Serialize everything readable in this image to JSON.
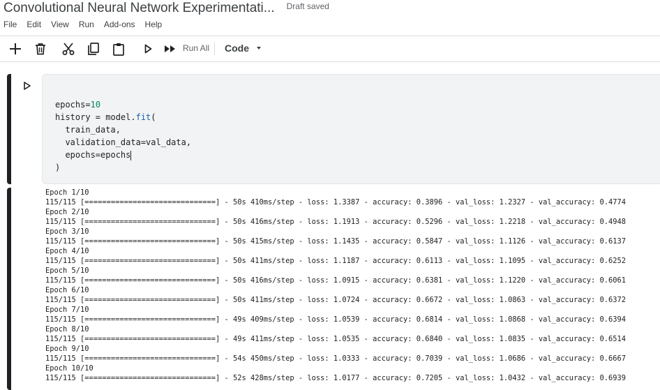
{
  "notebook": {
    "title": "Convolutional Neural Network Experimentati...",
    "save_status": "Draft saved"
  },
  "menu": [
    "File",
    "Edit",
    "View",
    "Run",
    "Add-ons",
    "Help"
  ],
  "toolbar": {
    "icons": [
      "plus-icon",
      "trash-icon",
      "scissors-icon",
      "copy-icon",
      "clipboard-icon",
      "play-icon",
      "fast-forward-icon"
    ],
    "run_all_label": "Run All",
    "cell_type": "Code"
  },
  "code_cell": {
    "line1": {
      "var": "epochs",
      "eq": "=",
      "num": "10"
    },
    "line2": {
      "pre": "history = model.",
      "fn": "fit",
      "post": "("
    },
    "line3": "  train_data,",
    "line4": "  validation_data=val_data,",
    "line5": "  epochs=epochs",
    "line6": ")"
  },
  "output": {
    "epochs": [
      {
        "header": "Epoch 1/10",
        "progress": "115/115 [==============================] - 50s 410ms/step - loss: 1.3387 - accuracy: 0.3896 - val_loss: 1.2327 - val_accuracy: 0.4774"
      },
      {
        "header": "Epoch 2/10",
        "progress": "115/115 [==============================] - 50s 416ms/step - loss: 1.1913 - accuracy: 0.5296 - val_loss: 1.2218 - val_accuracy: 0.4948"
      },
      {
        "header": "Epoch 3/10",
        "progress": "115/115 [==============================] - 50s 415ms/step - loss: 1.1435 - accuracy: 0.5847 - val_loss: 1.1126 - val_accuracy: 0.6137"
      },
      {
        "header": "Epoch 4/10",
        "progress": "115/115 [==============================] - 50s 411ms/step - loss: 1.1187 - accuracy: 0.6113 - val_loss: 1.1095 - val_accuracy: 0.6252"
      },
      {
        "header": "Epoch 5/10",
        "progress": "115/115 [==============================] - 50s 416ms/step - loss: 1.0915 - accuracy: 0.6381 - val_loss: 1.1220 - val_accuracy: 0.6061"
      },
      {
        "header": "Epoch 6/10",
        "progress": "115/115 [==============================] - 50s 411ms/step - loss: 1.0724 - accuracy: 0.6672 - val_loss: 1.0863 - val_accuracy: 0.6372"
      },
      {
        "header": "Epoch 7/10",
        "progress": "115/115 [==============================] - 49s 409ms/step - loss: 1.0539 - accuracy: 0.6814 - val_loss: 1.0868 - val_accuracy: 0.6394"
      },
      {
        "header": "Epoch 8/10",
        "progress": "115/115 [==============================] - 49s 411ms/step - loss: 1.0535 - accuracy: 0.6840 - val_loss: 1.0835 - val_accuracy: 0.6514"
      },
      {
        "header": "Epoch 9/10",
        "progress": "115/115 [==============================] - 54s 450ms/step - loss: 1.0333 - accuracy: 0.7039 - val_loss: 1.0686 - val_accuracy: 0.6667"
      },
      {
        "header": "Epoch 10/10",
        "progress": "115/115 [==============================] - 52s 428ms/step - loss: 1.0177 - accuracy: 0.7205 - val_loss: 1.0432 - val_accuracy: 0.6939"
      }
    ]
  },
  "colors": {
    "number": "#098658",
    "function": "#1a5fa8",
    "cell_bar": "#202124",
    "code_bg": "#f1f3f4"
  }
}
